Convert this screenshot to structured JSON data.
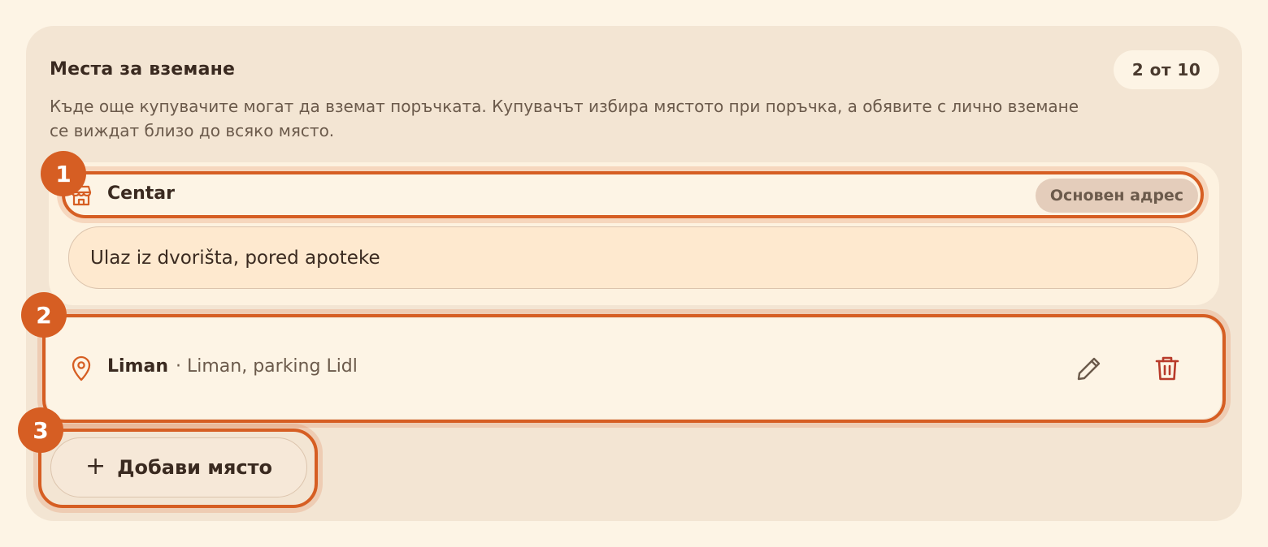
{
  "section": {
    "title": "Места за вземане",
    "counter": "2 от 10",
    "description": "Къде още купувачите могат да вземат поръчката. Купувачът избира мястото при поръчка, а обявите с лично вземане се виждат близо до всяко място."
  },
  "locations": [
    {
      "name": "Centar",
      "icon": "store-icon",
      "badge": "Основен адрес",
      "note_value": "Ulaz iz dvorišta, pored apoteke"
    },
    {
      "name": "Liman",
      "icon": "map-pin-icon",
      "detail": "· Liman, parking Lidl"
    }
  ],
  "actions": {
    "add_label": "Добави място"
  },
  "markers": [
    "1",
    "2",
    "3"
  ],
  "colors": {
    "accent": "#d65e23",
    "delete": "#b83a2a",
    "page_bg": "#fdf4e5",
    "card_bg": "#f3e5d3"
  }
}
